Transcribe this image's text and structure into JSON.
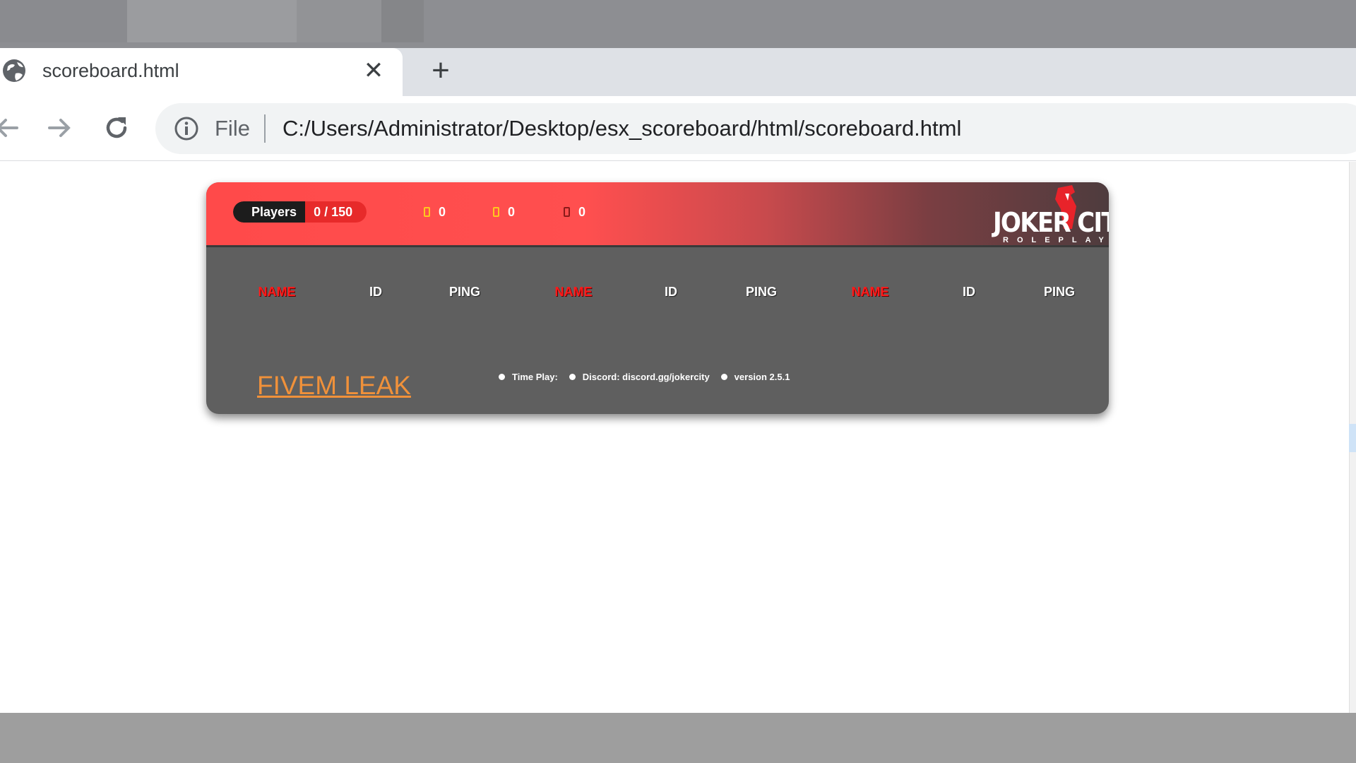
{
  "browser": {
    "tab_title": "scoreboard.html",
    "tab_close": "✕",
    "new_tab": "+",
    "address": {
      "scheme_label": "File",
      "url": "C:/Users/Administrator/Desktop/esx_scoreboard/html/scoreboard.html"
    }
  },
  "scoreboard": {
    "players_label": "Players",
    "players_count": "0 / 150",
    "jobs": [
      {
        "count": "0",
        "color": "#ffc81e"
      },
      {
        "count": "0",
        "color": "#ffc81e"
      },
      {
        "count": "0",
        "color": "#8a1a1a"
      }
    ],
    "logo": {
      "main": "JOKER CITY",
      "sub": "ROLEPLAY"
    },
    "columns": [
      "NAME",
      "ID",
      "PING",
      "NAME",
      "ID",
      "PING",
      "NAME",
      "ID",
      "PING"
    ],
    "footer_link": "FIVEM LEAK",
    "footer": {
      "time_play": "Time Play:",
      "discord": "Discord: discord.gg/jokercity",
      "version": "version 2.5.1"
    }
  },
  "colors": {
    "header_red": "#ff4a4a",
    "panel_gray": "#5f5f5f",
    "name_red": "#ff1a1a",
    "link_orange": "#f0913a"
  }
}
